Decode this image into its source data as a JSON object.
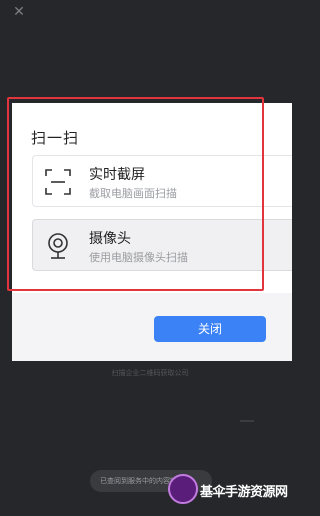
{
  "window": {
    "close_glyph": "✕"
  },
  "dialog": {
    "title": "扫一扫",
    "options": [
      {
        "title": "实时截屏",
        "subtitle": "截取电脑画面扫描",
        "icon": "screenshot-frame-icon",
        "selected": false
      },
      {
        "title": "摄像头",
        "subtitle": "使用电脑摄像头扫描",
        "icon": "camera-icon",
        "selected": true
      }
    ],
    "close_button": "关闭"
  },
  "background": {
    "caption": "扫描企业二维码获取公司",
    "toast": "已查阅到服务中的内容链接"
  },
  "watermark": {
    "text": "基伞手游资源网"
  },
  "colors": {
    "background": "#26272a",
    "accent": "#3b82f6",
    "highlight": "#e2343c"
  }
}
